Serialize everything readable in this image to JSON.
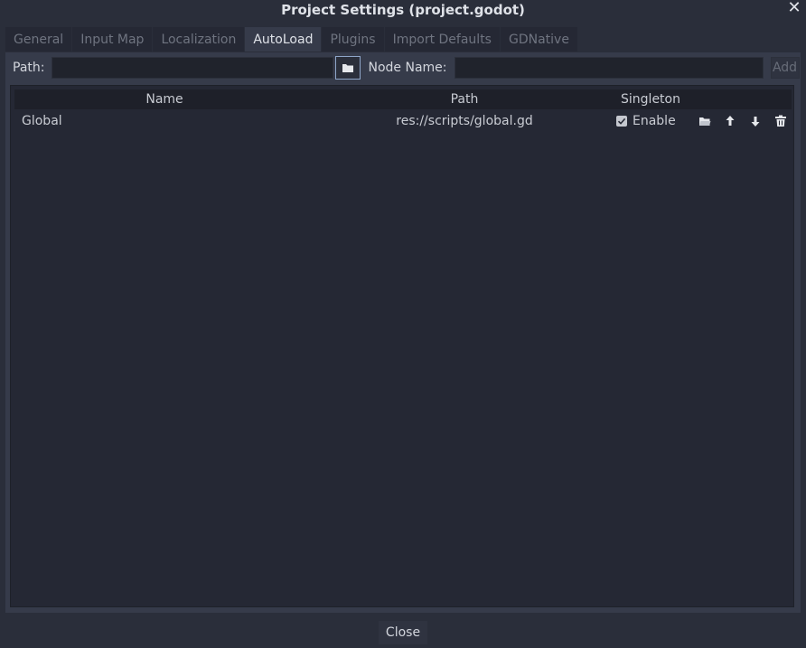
{
  "window": {
    "title": "Project Settings (project.godot)",
    "close_glyph": "✕"
  },
  "tabs": [
    {
      "label": "General"
    },
    {
      "label": "Input Map"
    },
    {
      "label": "Localization"
    },
    {
      "label": "AutoLoad"
    },
    {
      "label": "Plugins"
    },
    {
      "label": "Import Defaults"
    },
    {
      "label": "GDNative"
    }
  ],
  "active_tab": "AutoLoad",
  "toolbar": {
    "path_label": "Path:",
    "path_value": "",
    "node_name_label": "Node Name:",
    "node_name_value": "",
    "add_label": "Add",
    "browse_icon": "folder-icon"
  },
  "table": {
    "columns": [
      "Name",
      "Path",
      "Singleton"
    ],
    "rows": [
      {
        "name": "Global",
        "path": "res://scripts/global.gd",
        "singleton_checked": true,
        "singleton_label": "Enable",
        "actions": [
          "open-folder-icon",
          "move-up-icon",
          "move-down-icon",
          "delete-icon"
        ]
      }
    ]
  },
  "footer": {
    "close_label": "Close"
  },
  "colors": {
    "background": "#2a2e3a",
    "panel": "#363b4a",
    "tree": "#252834",
    "header": "#1e2029",
    "accent_border": "#8fa6c9"
  }
}
